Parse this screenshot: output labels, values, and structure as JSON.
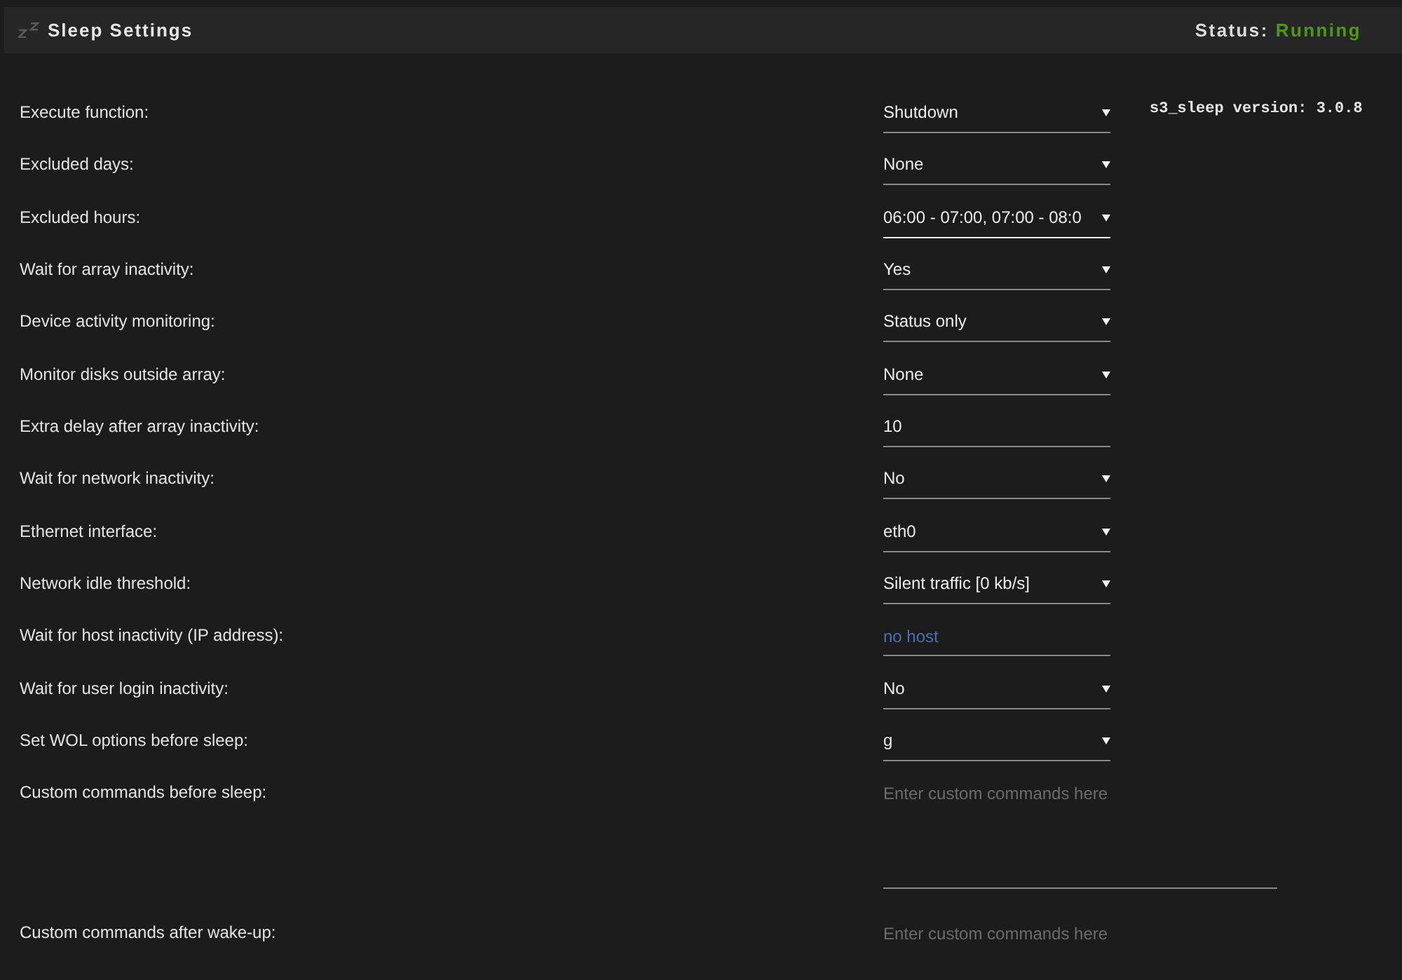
{
  "header": {
    "title": "Sleep Settings",
    "status_label": "Status:",
    "status_value": "Running"
  },
  "version": "s3_sleep version: 3.0.8",
  "settings": [
    {
      "label": "Execute function:",
      "kind": "select",
      "value": "Shutdown",
      "focused": false
    },
    {
      "label": "Excluded days:",
      "kind": "select",
      "value": "None",
      "focused": false
    },
    {
      "label": "Excluded hours:",
      "kind": "select",
      "value": "06:00 - 07:00, 07:00 - 08:0",
      "focused": true
    },
    {
      "label": "Wait for array inactivity:",
      "kind": "select",
      "value": "Yes",
      "focused": false
    },
    {
      "label": "Device activity monitoring:",
      "kind": "select",
      "value": "Status only",
      "focused": false
    },
    {
      "label": "Monitor disks outside array:",
      "kind": "select",
      "value": "None",
      "focused": false
    },
    {
      "label": "Extra delay after array inactivity:",
      "kind": "text",
      "value": "10",
      "focused": false
    },
    {
      "label": "Wait for network inactivity:",
      "kind": "select",
      "value": "No",
      "focused": false
    },
    {
      "label": "Ethernet interface:",
      "kind": "select",
      "value": "eth0",
      "focused": false
    },
    {
      "label": "Network idle threshold:",
      "kind": "select",
      "value": "Silent traffic [0 kb/s]",
      "focused": false
    },
    {
      "label": "Wait for host inactivity (IP address):",
      "kind": "text",
      "placeholder": "no host",
      "focused": false
    },
    {
      "label": "Wait for user login inactivity:",
      "kind": "select",
      "value": "No",
      "focused": false
    },
    {
      "label": "Set WOL options before sleep:",
      "kind": "select",
      "value": "g",
      "focused": false
    },
    {
      "label": "Custom commands before sleep:",
      "kind": "textarea",
      "placeholder": "Enter custom commands here",
      "focused": false
    },
    {
      "label": "Custom commands after wake-up:",
      "kind": "textarea",
      "placeholder": "Enter custom commands here",
      "focused": false
    }
  ]
}
